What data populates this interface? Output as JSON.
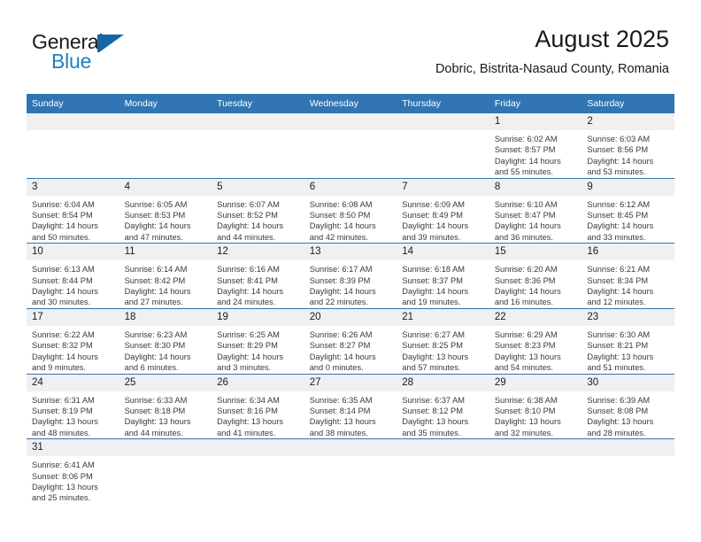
{
  "brand": {
    "name_part1": "General",
    "name_part2": "Blue",
    "triangle_color": "#1565a8",
    "blue_color": "#1f7fc4"
  },
  "header": {
    "title": "August 2025",
    "subtitle": "Dobric, Bistrita-Nasaud County, Romania",
    "header_bg": "#3175b4",
    "daynum_bg": "#f0f0f0",
    "row_divider": "#3175b4"
  },
  "weekdays": [
    "Sunday",
    "Monday",
    "Tuesday",
    "Wednesday",
    "Thursday",
    "Friday",
    "Saturday"
  ],
  "weeks": [
    [
      {
        "day": "",
        "lines": []
      },
      {
        "day": "",
        "lines": []
      },
      {
        "day": "",
        "lines": []
      },
      {
        "day": "",
        "lines": []
      },
      {
        "day": "",
        "lines": []
      },
      {
        "day": "1",
        "lines": [
          "Sunrise: 6:02 AM",
          "Sunset: 8:57 PM",
          "Daylight: 14 hours",
          "and 55 minutes."
        ]
      },
      {
        "day": "2",
        "lines": [
          "Sunrise: 6:03 AM",
          "Sunset: 8:56 PM",
          "Daylight: 14 hours",
          "and 53 minutes."
        ]
      }
    ],
    [
      {
        "day": "3",
        "lines": [
          "Sunrise: 6:04 AM",
          "Sunset: 8:54 PM",
          "Daylight: 14 hours",
          "and 50 minutes."
        ]
      },
      {
        "day": "4",
        "lines": [
          "Sunrise: 6:05 AM",
          "Sunset: 8:53 PM",
          "Daylight: 14 hours",
          "and 47 minutes."
        ]
      },
      {
        "day": "5",
        "lines": [
          "Sunrise: 6:07 AM",
          "Sunset: 8:52 PM",
          "Daylight: 14 hours",
          "and 44 minutes."
        ]
      },
      {
        "day": "6",
        "lines": [
          "Sunrise: 6:08 AM",
          "Sunset: 8:50 PM",
          "Daylight: 14 hours",
          "and 42 minutes."
        ]
      },
      {
        "day": "7",
        "lines": [
          "Sunrise: 6:09 AM",
          "Sunset: 8:49 PM",
          "Daylight: 14 hours",
          "and 39 minutes."
        ]
      },
      {
        "day": "8",
        "lines": [
          "Sunrise: 6:10 AM",
          "Sunset: 8:47 PM",
          "Daylight: 14 hours",
          "and 36 minutes."
        ]
      },
      {
        "day": "9",
        "lines": [
          "Sunrise: 6:12 AM",
          "Sunset: 8:45 PM",
          "Daylight: 14 hours",
          "and 33 minutes."
        ]
      }
    ],
    [
      {
        "day": "10",
        "lines": [
          "Sunrise: 6:13 AM",
          "Sunset: 8:44 PM",
          "Daylight: 14 hours",
          "and 30 minutes."
        ]
      },
      {
        "day": "11",
        "lines": [
          "Sunrise: 6:14 AM",
          "Sunset: 8:42 PM",
          "Daylight: 14 hours",
          "and 27 minutes."
        ]
      },
      {
        "day": "12",
        "lines": [
          "Sunrise: 6:16 AM",
          "Sunset: 8:41 PM",
          "Daylight: 14 hours",
          "and 24 minutes."
        ]
      },
      {
        "day": "13",
        "lines": [
          "Sunrise: 6:17 AM",
          "Sunset: 8:39 PM",
          "Daylight: 14 hours",
          "and 22 minutes."
        ]
      },
      {
        "day": "14",
        "lines": [
          "Sunrise: 6:18 AM",
          "Sunset: 8:37 PM",
          "Daylight: 14 hours",
          "and 19 minutes."
        ]
      },
      {
        "day": "15",
        "lines": [
          "Sunrise: 6:20 AM",
          "Sunset: 8:36 PM",
          "Daylight: 14 hours",
          "and 16 minutes."
        ]
      },
      {
        "day": "16",
        "lines": [
          "Sunrise: 6:21 AM",
          "Sunset: 8:34 PM",
          "Daylight: 14 hours",
          "and 12 minutes."
        ]
      }
    ],
    [
      {
        "day": "17",
        "lines": [
          "Sunrise: 6:22 AM",
          "Sunset: 8:32 PM",
          "Daylight: 14 hours",
          "and 9 minutes."
        ]
      },
      {
        "day": "18",
        "lines": [
          "Sunrise: 6:23 AM",
          "Sunset: 8:30 PM",
          "Daylight: 14 hours",
          "and 6 minutes."
        ]
      },
      {
        "day": "19",
        "lines": [
          "Sunrise: 6:25 AM",
          "Sunset: 8:29 PM",
          "Daylight: 14 hours",
          "and 3 minutes."
        ]
      },
      {
        "day": "20",
        "lines": [
          "Sunrise: 6:26 AM",
          "Sunset: 8:27 PM",
          "Daylight: 14 hours",
          "and 0 minutes."
        ]
      },
      {
        "day": "21",
        "lines": [
          "Sunrise: 6:27 AM",
          "Sunset: 8:25 PM",
          "Daylight: 13 hours",
          "and 57 minutes."
        ]
      },
      {
        "day": "22",
        "lines": [
          "Sunrise: 6:29 AM",
          "Sunset: 8:23 PM",
          "Daylight: 13 hours",
          "and 54 minutes."
        ]
      },
      {
        "day": "23",
        "lines": [
          "Sunrise: 6:30 AM",
          "Sunset: 8:21 PM",
          "Daylight: 13 hours",
          "and 51 minutes."
        ]
      }
    ],
    [
      {
        "day": "24",
        "lines": [
          "Sunrise: 6:31 AM",
          "Sunset: 8:19 PM",
          "Daylight: 13 hours",
          "and 48 minutes."
        ]
      },
      {
        "day": "25",
        "lines": [
          "Sunrise: 6:33 AM",
          "Sunset: 8:18 PM",
          "Daylight: 13 hours",
          "and 44 minutes."
        ]
      },
      {
        "day": "26",
        "lines": [
          "Sunrise: 6:34 AM",
          "Sunset: 8:16 PM",
          "Daylight: 13 hours",
          "and 41 minutes."
        ]
      },
      {
        "day": "27",
        "lines": [
          "Sunrise: 6:35 AM",
          "Sunset: 8:14 PM",
          "Daylight: 13 hours",
          "and 38 minutes."
        ]
      },
      {
        "day": "28",
        "lines": [
          "Sunrise: 6:37 AM",
          "Sunset: 8:12 PM",
          "Daylight: 13 hours",
          "and 35 minutes."
        ]
      },
      {
        "day": "29",
        "lines": [
          "Sunrise: 6:38 AM",
          "Sunset: 8:10 PM",
          "Daylight: 13 hours",
          "and 32 minutes."
        ]
      },
      {
        "day": "30",
        "lines": [
          "Sunrise: 6:39 AM",
          "Sunset: 8:08 PM",
          "Daylight: 13 hours",
          "and 28 minutes."
        ]
      }
    ],
    [
      {
        "day": "31",
        "lines": [
          "Sunrise: 6:41 AM",
          "Sunset: 8:06 PM",
          "Daylight: 13 hours",
          "and 25 minutes."
        ]
      },
      {
        "day": "",
        "lines": []
      },
      {
        "day": "",
        "lines": []
      },
      {
        "day": "",
        "lines": []
      },
      {
        "day": "",
        "lines": []
      },
      {
        "day": "",
        "lines": []
      },
      {
        "day": "",
        "lines": []
      }
    ]
  ]
}
